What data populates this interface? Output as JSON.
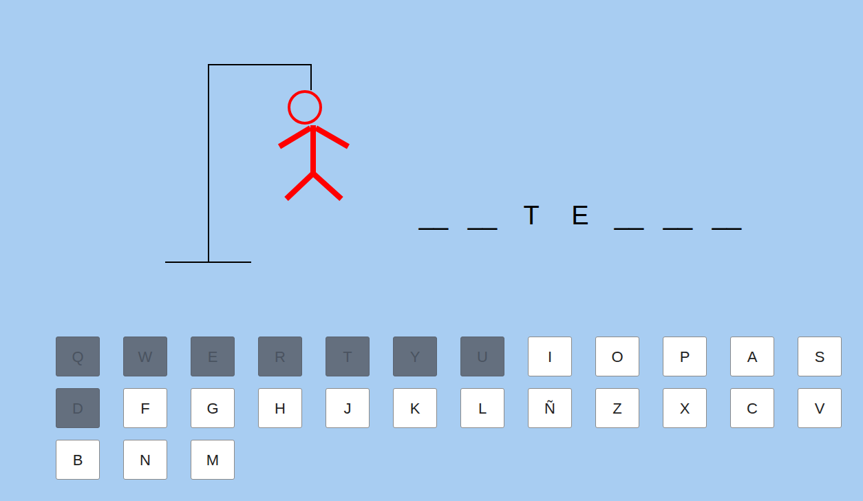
{
  "hangman": {
    "parts": [
      {
        "kind": "head",
        "shown": true
      },
      {
        "kind": "body",
        "shown": true
      },
      {
        "kind": "left-arm",
        "shown": true
      },
      {
        "kind": "right-arm",
        "shown": true
      },
      {
        "kind": "left-leg",
        "shown": true
      },
      {
        "kind": "right-leg",
        "shown": true
      }
    ]
  },
  "word": {
    "slots": [
      "__",
      "__",
      "T",
      "E",
      "__",
      "__",
      "__"
    ]
  },
  "keyboard": {
    "rows": [
      [
        {
          "label": "Q",
          "disabled": true
        },
        {
          "label": "W",
          "disabled": true
        },
        {
          "label": "E",
          "disabled": true
        },
        {
          "label": "R",
          "disabled": true
        },
        {
          "label": "T",
          "disabled": true
        },
        {
          "label": "Y",
          "disabled": true
        },
        {
          "label": "U",
          "disabled": true
        },
        {
          "label": "I",
          "disabled": false
        },
        {
          "label": "O",
          "disabled": false
        },
        {
          "label": "P",
          "disabled": false
        },
        {
          "label": "A",
          "disabled": false
        },
        {
          "label": "S",
          "disabled": false
        }
      ],
      [
        {
          "label": "D",
          "disabled": true
        },
        {
          "label": "F",
          "disabled": false
        },
        {
          "label": "G",
          "disabled": false
        },
        {
          "label": "H",
          "disabled": false
        },
        {
          "label": "J",
          "disabled": false
        },
        {
          "label": "K",
          "disabled": false
        },
        {
          "label": "L",
          "disabled": false
        },
        {
          "label": "Ñ",
          "disabled": false
        },
        {
          "label": "Z",
          "disabled": false
        },
        {
          "label": "X",
          "disabled": false
        },
        {
          "label": "C",
          "disabled": false
        },
        {
          "label": "V",
          "disabled": false
        }
      ],
      [
        {
          "label": "B",
          "disabled": false
        },
        {
          "label": "N",
          "disabled": false
        },
        {
          "label": "M",
          "disabled": false
        }
      ]
    ]
  }
}
